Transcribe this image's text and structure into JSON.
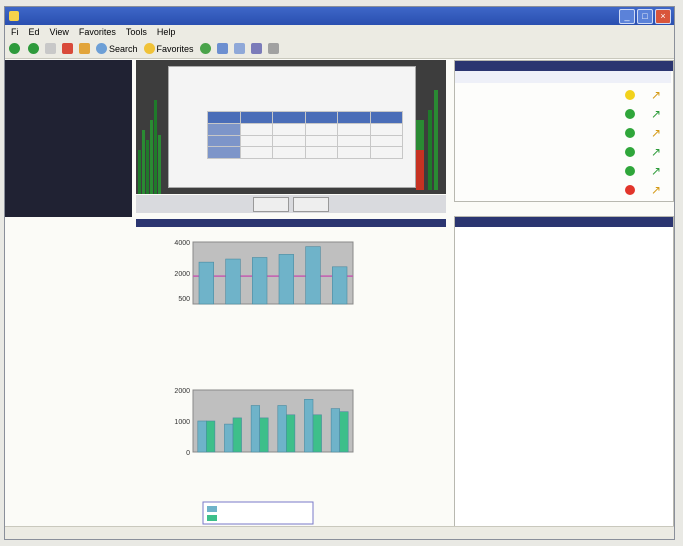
{
  "window": {
    "title": "",
    "menu": [
      "Fi",
      "Ed",
      "View",
      "Favorites",
      "Tools",
      "Help"
    ]
  },
  "toolbar": {
    "back_label": "",
    "search_label": "Search",
    "favorites_label": "Favorites"
  },
  "leftnav": {
    "items": [
      "",
      "",
      "",
      "",
      "",
      "",
      "",
      "",
      "",
      "",
      "",
      "",
      "",
      ""
    ]
  },
  "viewer": {
    "dialog_title": "",
    "prev_label": "",
    "next_label": ""
  },
  "status_panel": {
    "rows": [
      {
        "label": "",
        "color": "#f2d21c",
        "arrow_color": "#d49a16"
      },
      {
        "label": "",
        "color": "#2fa63a",
        "arrow_color": "#2d9b3a"
      },
      {
        "label": "",
        "color": "#2fa63a",
        "arrow_color": "#d49a16"
      },
      {
        "label": "",
        "color": "#2fa63a",
        "arrow_color": "#2d9b3a"
      },
      {
        "label": "",
        "color": "#2fa63a",
        "arrow_color": "#2d9b3a"
      },
      {
        "label": "",
        "color": "#e2352b",
        "arrow_color": "#d49a16"
      }
    ]
  },
  "links_panel": {
    "items": [
      "",
      "",
      "",
      "",
      "",
      "",
      "",
      "",
      "",
      "",
      "",
      "",
      "",
      "",
      "",
      ""
    ]
  },
  "chart_data": [
    {
      "type": "bar",
      "title": "",
      "xlabel": "",
      "ylabel": "",
      "categories": [
        "",
        "",
        "",
        "",
        "",
        ""
      ],
      "ylim": [
        0,
        4000
      ],
      "yticks": [
        "4000",
        "2000",
        "500"
      ],
      "series": [
        {
          "values": [
            2700,
            2900,
            3000,
            3200,
            3700,
            2400
          ],
          "color": "#6fb3c9"
        }
      ],
      "reference_line": 1800
    },
    {
      "type": "bar",
      "title": "",
      "xlabel": "",
      "ylabel": "",
      "categories": [
        "",
        "",
        "",
        "",
        "",
        ""
      ],
      "ylim": [
        0,
        2000
      ],
      "yticks": [
        "2000",
        "1000",
        "0"
      ],
      "series": [
        {
          "name": "",
          "values": [
            1000,
            900,
            1500,
            1500,
            1700,
            1400
          ],
          "color": "#6fb3c9"
        },
        {
          "name": "",
          "values": [
            1000,
            1100,
            1100,
            1200,
            1200,
            1300
          ],
          "color": "#3dbf8a"
        }
      ]
    }
  ]
}
